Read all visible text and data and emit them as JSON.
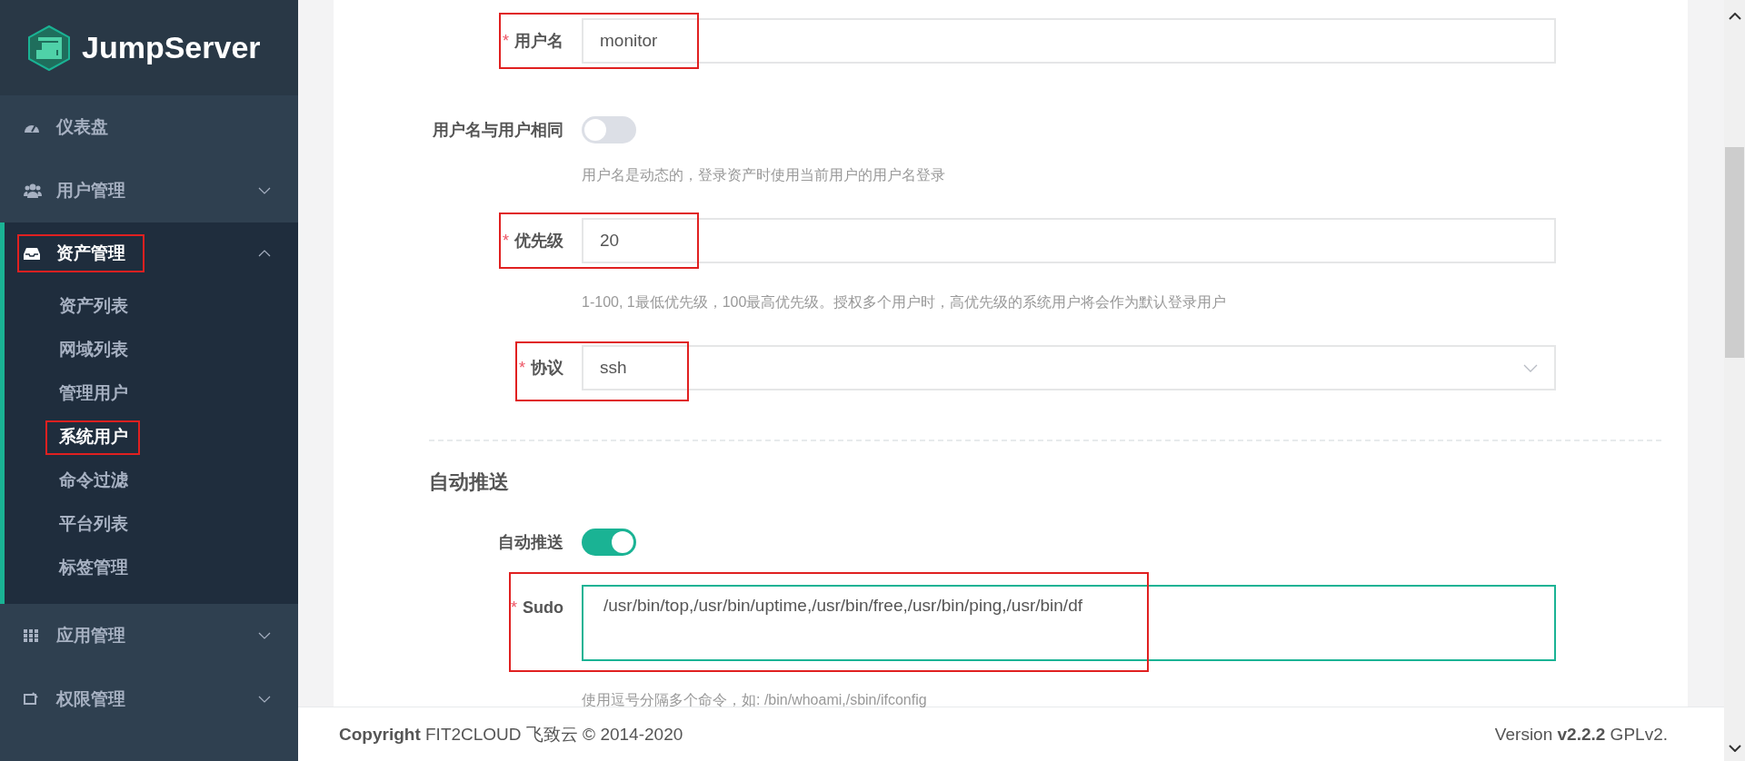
{
  "logo": {
    "text": "JumpServer"
  },
  "nav": [
    {
      "kind": "link",
      "label": "仪表盘",
      "highlighted": false
    },
    {
      "kind": "group",
      "label": "用户管理",
      "expanded": false,
      "highlighted": false
    },
    {
      "kind": "group",
      "label": "资产管理",
      "expanded": true,
      "highlighted": true,
      "children": [
        {
          "label": "资产列表",
          "selected": false,
          "highlighted": false
        },
        {
          "label": "网域列表",
          "selected": false,
          "highlighted": false
        },
        {
          "label": "管理用户",
          "selected": false,
          "highlighted": false
        },
        {
          "label": "系统用户",
          "selected": true,
          "highlighted": true
        },
        {
          "label": "命令过滤",
          "selected": false,
          "highlighted": false
        },
        {
          "label": "平台列表",
          "selected": false,
          "highlighted": false
        },
        {
          "label": "标签管理",
          "selected": false,
          "highlighted": false
        }
      ]
    },
    {
      "kind": "group",
      "label": "应用管理",
      "expanded": false,
      "highlighted": false
    },
    {
      "kind": "group",
      "label": "权限管理",
      "expanded": false,
      "highlighted": false
    }
  ],
  "form": {
    "sections": [
      {
        "fields": [
          {
            "kind": "input",
            "label": "用户名",
            "required_mark": "*",
            "value": "monitor",
            "highlighted": true
          },
          {
            "kind": "switch",
            "label": "用户名与用户相同",
            "on": false,
            "help": "用户名是动态的，登录资产时使用当前用户的用户名登录",
            "highlighted": false
          },
          {
            "kind": "input",
            "label": "优先级",
            "required_mark": "*",
            "value": "20",
            "help": "1-100, 1最低优先级，100最高优先级。授权多个用户时，高优先级的系统用户将会作为默认登录用户",
            "highlighted": true
          },
          {
            "kind": "select",
            "label": "协议",
            "required_mark": "*",
            "value": "ssh",
            "highlighted": true
          }
        ]
      },
      {
        "title": "自动推送",
        "fields": [
          {
            "kind": "switch",
            "label": "自动推送",
            "on": true,
            "highlighted": false
          },
          {
            "kind": "textarea",
            "label": "Sudo",
            "required_mark": "*",
            "value": "/usr/bin/top,/usr/bin/uptime,/usr/bin/free,/usr/bin/ping,/usr/bin/df",
            "help": "使用逗号分隔多个命令，如: /bin/whoami,/sbin/ifconfig",
            "highlighted": true
          }
        ]
      }
    ]
  },
  "footer": {
    "copyright": "**Copyright** FIT2CLOUD 飞致云 © 2014-2020",
    "version": "Version **v2.2.2** GPLv2."
  }
}
